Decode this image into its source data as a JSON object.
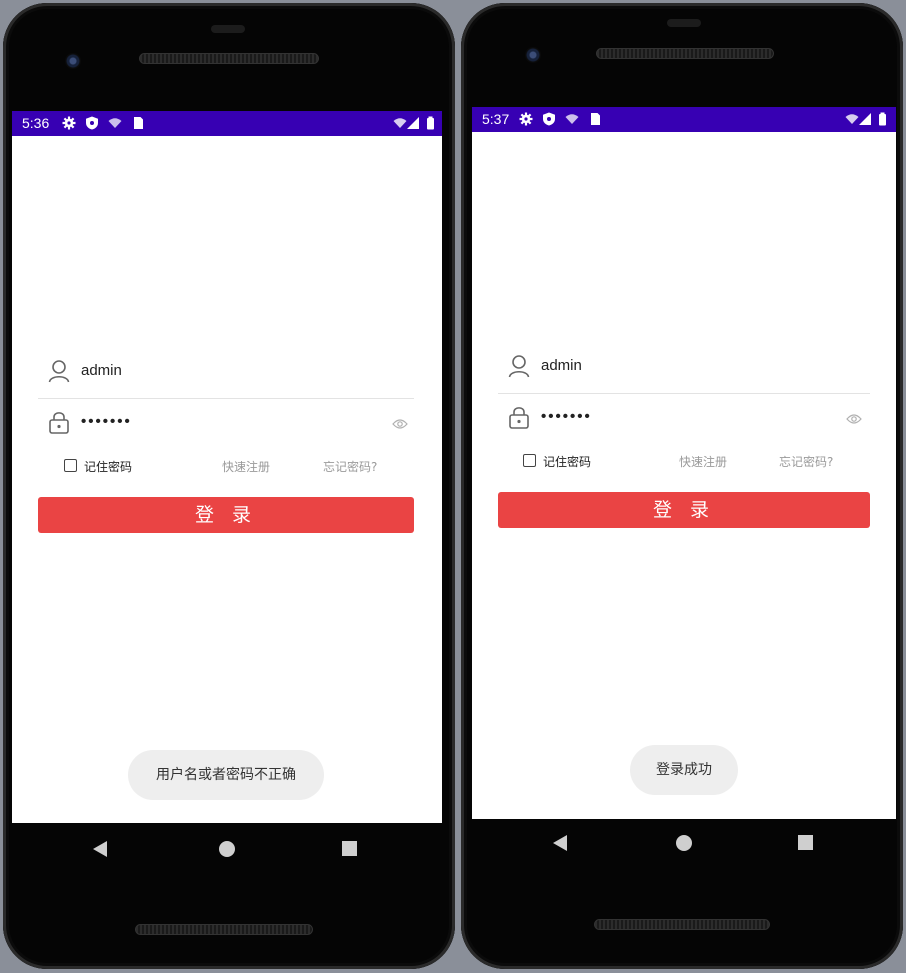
{
  "left_phone": {
    "status": {
      "time": "5:36"
    },
    "login": {
      "username": "admin",
      "password_mask": "•••••••",
      "remember_label": "记住密码",
      "register_link": "快速注册",
      "forgot_link": "忘记密码?",
      "login_button": "登 录"
    },
    "toast": "用户名或者密码不正确"
  },
  "right_phone": {
    "status": {
      "time": "5:37"
    },
    "login": {
      "username": "admin",
      "password_mask": "•••••••",
      "remember_label": "记住密码",
      "register_link": "快速注册",
      "forgot_link": "忘记密码?",
      "login_button": "登 录"
    },
    "toast": "登录成功"
  },
  "colors": {
    "status_bar": "#3700b3",
    "login_button": "#ea4444",
    "toast_bg": "#eeeeee"
  },
  "icons": [
    "settings-icon",
    "shield-icon",
    "wifi-icon",
    "sim-card-icon",
    "signal-icon",
    "battery-icon",
    "user-icon",
    "lock-icon",
    "eye-icon",
    "nav-back-icon",
    "nav-home-icon",
    "nav-recents-icon"
  ]
}
